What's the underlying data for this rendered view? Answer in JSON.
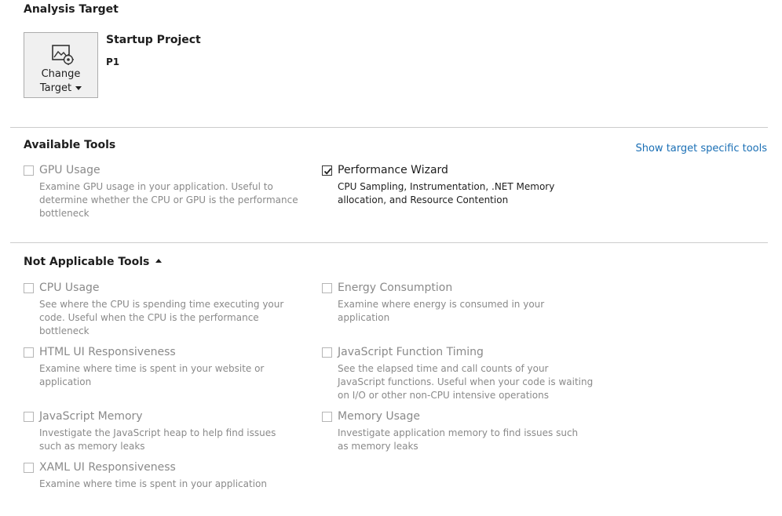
{
  "analysis_target": {
    "heading": "Analysis Target",
    "change_target_line1": "Change",
    "change_target_line2": "Target",
    "change_target_icon": "image-gear-icon",
    "startup_project_label": "Startup Project",
    "project_name": "P1"
  },
  "available_tools": {
    "heading": "Available Tools",
    "link": "Show target specific tools",
    "tools": [
      {
        "name": "GPU Usage",
        "description": "Examine GPU usage in your application. Useful to determine whether the CPU or GPU is the performance bottleneck",
        "checked": false,
        "enabled": false
      },
      {
        "name": "Performance Wizard",
        "description": "CPU Sampling, Instrumentation, .NET Memory allocation, and Resource Contention",
        "checked": true,
        "enabled": true
      }
    ]
  },
  "not_applicable_tools": {
    "heading": "Not Applicable Tools",
    "tools": [
      {
        "name": "CPU Usage",
        "description": "See where the CPU is spending time executing your code. Useful when the CPU is the performance bottleneck",
        "checked": false
      },
      {
        "name": "Energy Consumption",
        "description": "Examine where energy is consumed in your application",
        "checked": false
      },
      {
        "name": "HTML UI Responsiveness",
        "description": "Examine where time is spent in your website or application",
        "checked": false
      },
      {
        "name": "JavaScript Function Timing",
        "description": "See the elapsed time and call counts of your JavaScript functions. Useful when your code is waiting on I/O or other non-CPU intensive operations",
        "checked": false
      },
      {
        "name": "JavaScript Memory",
        "description": "Investigate the JavaScript heap to help find issues such as memory leaks",
        "checked": false
      },
      {
        "name": "Memory Usage",
        "description": "Investigate application memory to find issues such as memory leaks",
        "checked": false
      },
      {
        "name": "XAML UI Responsiveness",
        "description": "Examine where time is spent in your application",
        "checked": false
      }
    ]
  },
  "colors": {
    "link": "#1a6fb5",
    "disabled_text": "#8a8a8a",
    "text": "#1e1e1e",
    "divider": "#cccccc"
  }
}
